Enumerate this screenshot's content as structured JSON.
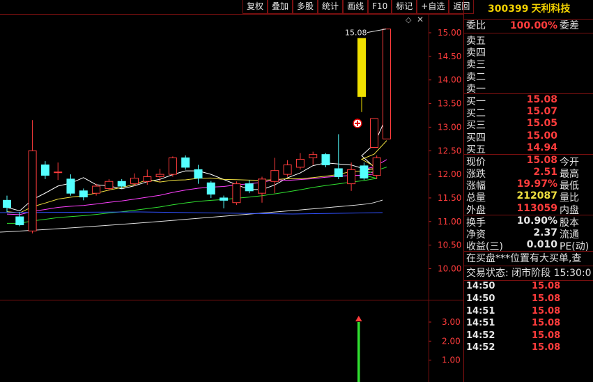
{
  "toolbar": [
    "复权",
    "叠加",
    "多股",
    "统计",
    "画线",
    "F10",
    "标记",
    "+自选",
    "返回"
  ],
  "stock": {
    "code": "300399",
    "name": "天利科技"
  },
  "ratio": {
    "label": "委比",
    "value": "100.00%",
    "label2": "委差"
  },
  "asks": [
    "卖五",
    "卖四",
    "卖三",
    "卖二",
    "卖一"
  ],
  "bids": [
    {
      "label": "买一",
      "price": "15.08"
    },
    {
      "label": "买二",
      "price": "15.07"
    },
    {
      "label": "买三",
      "price": "15.05"
    },
    {
      "label": "买四",
      "price": "15.00"
    },
    {
      "label": "买五",
      "price": "14.94"
    }
  ],
  "quote": [
    {
      "label": "现价",
      "value": "15.08",
      "label2": "今开",
      "color": "red"
    },
    {
      "label": "涨跌",
      "value": "2.51",
      "label2": "最高",
      "color": "red"
    },
    {
      "label": "涨幅",
      "value": "19.97%",
      "label2": "最低",
      "color": "red"
    },
    {
      "label": "总量",
      "value": "212087",
      "label2": "量比",
      "color": "yel"
    },
    {
      "label": "外盘",
      "value": "113059",
      "label2": "内盘",
      "color": "red"
    }
  ],
  "fundamentals": [
    {
      "label": "换手",
      "value": "10.90%",
      "label2": "股本"
    },
    {
      "label": "净资",
      "value": "2.37",
      "label2": "流通"
    },
    {
      "label": "收益(三)",
      "value": "0.010",
      "label2": "PE(动)"
    }
  ],
  "messages": [
    "在买盘***位置有大买单,查",
    "交易状态: 闭市阶段 15:30:0"
  ],
  "trades": [
    {
      "time": "14:50",
      "price": "15.08"
    },
    {
      "time": "14:50",
      "price": "15.08"
    },
    {
      "time": "14:51",
      "price": "15.08"
    },
    {
      "time": "14:51",
      "price": "15.08"
    },
    {
      "time": "14:52",
      "price": "15.08"
    },
    {
      "time": "14:52",
      "price": "15.08"
    }
  ],
  "chart": {
    "price_ticks": [
      "15.00",
      "14.50",
      "14.00",
      "13.50",
      "13.00",
      "12.50",
      "12.00",
      "11.50",
      "11.00",
      "10.50",
      "10.00"
    ],
    "volume_ticks": [
      "3.00",
      "2.00",
      "1.00"
    ],
    "high_label": "15.08",
    "colors": {
      "up": "#ff3c3c",
      "down": "#54ffff",
      "ma5": "#ffffff",
      "ma10": "#f0e040",
      "ma20": "#ff40ff",
      "ma30": "#30e030",
      "ma60": "#e0e0e0",
      "ma120": "#3050ff",
      "volume": "#30e030",
      "limit_day": "#f0e000"
    }
  },
  "chart_data": {
    "type": "candlestick",
    "price_range": [
      9.6,
      15.3
    ],
    "candles": [
      {
        "o": 11.45,
        "c": 11.3,
        "h": 11.55,
        "l": 11.2
      },
      {
        "o": 11.1,
        "c": 10.93,
        "h": 11.2,
        "l": 10.9
      },
      {
        "o": 10.8,
        "c": 12.5,
        "h": 13.15,
        "l": 10.75
      },
      {
        "o": 12.2,
        "c": 11.98,
        "h": 12.28,
        "l": 11.9
      },
      {
        "o": 12.05,
        "c": 12.05,
        "h": 12.25,
        "l": 11.88
      },
      {
        "o": 11.9,
        "c": 11.6,
        "h": 12.0,
        "l": 11.55
      },
      {
        "o": 11.65,
        "c": 11.52,
        "h": 11.7,
        "l": 11.45
      },
      {
        "o": 11.6,
        "c": 11.75,
        "h": 11.8,
        "l": 11.55
      },
      {
        "o": 11.7,
        "c": 11.85,
        "h": 11.9,
        "l": 11.65
      },
      {
        "o": 11.85,
        "c": 11.75,
        "h": 11.9,
        "l": 11.7
      },
      {
        "o": 11.8,
        "c": 11.92,
        "h": 12.02,
        "l": 11.75
      },
      {
        "o": 11.85,
        "c": 11.95,
        "h": 12.1,
        "l": 11.78
      },
      {
        "o": 11.95,
        "c": 12.0,
        "h": 12.12,
        "l": 11.85
      },
      {
        "o": 12.0,
        "c": 12.35,
        "h": 12.38,
        "l": 11.95
      },
      {
        "o": 12.35,
        "c": 12.15,
        "h": 12.4,
        "l": 12.1
      },
      {
        "o": 12.1,
        "c": 11.92,
        "h": 12.2,
        "l": 11.8
      },
      {
        "o": 11.82,
        "c": 11.58,
        "h": 11.86,
        "l": 11.5
      },
      {
        "o": 11.5,
        "c": 11.45,
        "h": 11.55,
        "l": 11.28
      },
      {
        "o": 11.4,
        "c": 11.8,
        "h": 11.85,
        "l": 11.35
      },
      {
        "o": 11.8,
        "c": 11.65,
        "h": 11.88,
        "l": 11.6
      },
      {
        "o": 11.6,
        "c": 11.9,
        "h": 11.95,
        "l": 11.4
      },
      {
        "o": 11.85,
        "c": 12.08,
        "h": 12.35,
        "l": 11.6
      },
      {
        "o": 12.0,
        "c": 12.2,
        "h": 12.3,
        "l": 11.95
      },
      {
        "o": 12.15,
        "c": 12.32,
        "h": 12.45,
        "l": 12.1
      },
      {
        "o": 12.35,
        "c": 12.42,
        "h": 12.48,
        "l": 12.2
      },
      {
        "o": 12.42,
        "c": 12.2,
        "h": 12.45,
        "l": 12.15
      },
      {
        "o": 12.12,
        "c": 11.95,
        "h": 12.85,
        "l": 11.9
      },
      {
        "o": 11.8,
        "c": 12.1,
        "h": 12.25,
        "l": 11.65
      },
      {
        "o": 12.18,
        "c": 11.92,
        "h": 12.25,
        "l": 11.88
      },
      {
        "o": 11.98,
        "c": 12.35,
        "h": 12.4,
        "l": 11.9
      },
      {
        "o": 14.88,
        "c": 13.65,
        "h": 14.88,
        "l": 13.32
      },
      {
        "o": 12.57,
        "c": 13.18,
        "h": 13.18,
        "l": 12.57
      },
      {
        "o": 12.75,
        "c": 15.08,
        "h": 15.08,
        "l": 12.75
      }
    ],
    "volume": [
      {
        "index": 30,
        "value": 3.0
      }
    ],
    "volume_range": [
      0,
      3.5
    ]
  }
}
